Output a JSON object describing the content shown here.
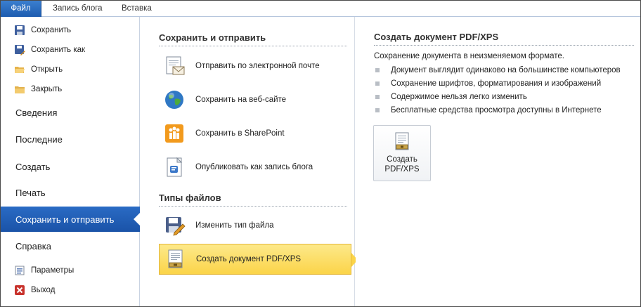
{
  "tabs": [
    {
      "label": "Файл"
    },
    {
      "label": "Запись блога"
    },
    {
      "label": "Вставка"
    }
  ],
  "nav": {
    "small_top": [
      {
        "label": "Сохранить",
        "icon": "save-icon"
      },
      {
        "label": "Сохранить как",
        "icon": "save-as-icon"
      },
      {
        "label": "Открыть",
        "icon": "open-folder-icon"
      },
      {
        "label": "Закрыть",
        "icon": "close-folder-icon"
      }
    ],
    "big": [
      {
        "label": "Сведения"
      },
      {
        "label": "Последние"
      },
      {
        "label": "Создать"
      },
      {
        "label": "Печать"
      },
      {
        "label": "Сохранить и отправить"
      },
      {
        "label": "Справка"
      }
    ],
    "small_bottom": [
      {
        "label": "Параметры",
        "icon": "options-icon"
      },
      {
        "label": "Выход",
        "icon": "exit-icon"
      }
    ]
  },
  "middle": {
    "section1_title": "Сохранить и отправить",
    "section1_items": [
      {
        "label": "Отправить по электронной почте",
        "icon": "email-icon"
      },
      {
        "label": "Сохранить на веб-сайте",
        "icon": "globe-icon"
      },
      {
        "label": "Сохранить в SharePoint",
        "icon": "sharepoint-icon"
      },
      {
        "label": "Опубликовать как запись блога",
        "icon": "blog-icon"
      }
    ],
    "section2_title": "Типы файлов",
    "section2_items": [
      {
        "label": "Изменить тип файла",
        "icon": "change-file-type-icon"
      },
      {
        "label": "Создать документ PDF/XPS",
        "icon": "pdf-xps-icon"
      }
    ]
  },
  "right": {
    "title": "Создать документ PDF/XPS",
    "description": "Сохранение документа в неизменяемом формате.",
    "bullets": [
      "Документ выглядит одинаково на большинстве компьютеров",
      "Сохранение шрифтов, форматирования и изображений",
      "Содержимое нельзя легко изменить",
      "Бесплатные средства просмотра доступны в Интернете"
    ],
    "button_line1": "Создать",
    "button_line2": "PDF/XPS"
  },
  "colors": {
    "active_nav": "#1d5cb0",
    "selected_option": "#fbd449"
  }
}
